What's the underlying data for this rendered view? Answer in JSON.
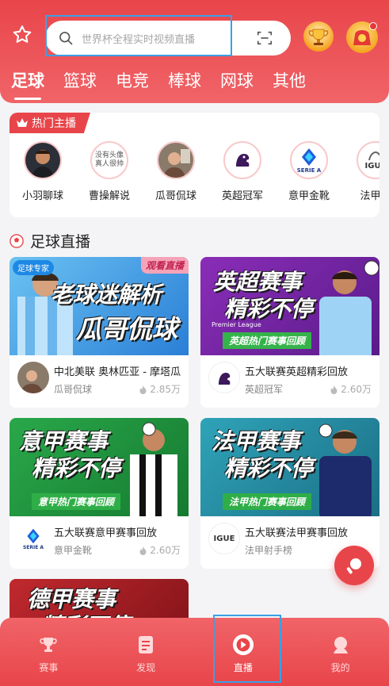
{
  "search": {
    "placeholder": "世界杯全程实时视频直播"
  },
  "tabs": [
    {
      "label": "足球",
      "active": true
    },
    {
      "label": "篮球"
    },
    {
      "label": "电竞"
    },
    {
      "label": "棒球"
    },
    {
      "label": "网球"
    },
    {
      "label": "其他"
    }
  ],
  "hot": {
    "tag": "热门主播",
    "streamers": [
      {
        "name": "小羽聊球"
      },
      {
        "name": "曹操解说",
        "avatar_text": "没有头像 真人很帅"
      },
      {
        "name": "瓜哥侃球"
      },
      {
        "name": "英超冠军"
      },
      {
        "name": "意甲金靴",
        "avatar_text": "SERIE A"
      },
      {
        "name": "法甲射",
        "avatar_text": "IGUE"
      }
    ]
  },
  "section": {
    "title": "足球直播"
  },
  "videos": [
    {
      "thumb_line1": "老球迷解析",
      "thumb_line2": "瓜哥侃球",
      "corner": "观看直播",
      "label_tl": "足球专家",
      "title": "中北美联 奥林匹亚 - 摩塔瓜",
      "host": "瓜哥侃球",
      "views": "2.85万"
    },
    {
      "thumb_line1": "英超赛事",
      "thumb_line2": "精彩不停",
      "strip": "英超热门赛事回顾",
      "caption": "Premier League",
      "title": "五大联赛英超精彩回放",
      "host": "英超冠军",
      "views": "2.60万"
    },
    {
      "thumb_line1": "意甲赛事",
      "thumb_line2": "精彩不停",
      "strip": "意甲热门赛事回顾",
      "title": "五大联赛意甲赛事回放",
      "host": "意甲金靴",
      "views": "2.60万",
      "host_avatar_text": "SERIE A"
    },
    {
      "thumb_line1": "法甲赛事",
      "thumb_line2": "精彩不停",
      "strip": "法甲热门赛事回顾",
      "title": "五大联赛法甲赛事回放",
      "host": "法甲射手榜",
      "views": "",
      "host_avatar_text": "IGUE"
    },
    {
      "thumb_line1": "德甲赛事",
      "thumb_line2": "精彩不停"
    }
  ],
  "nav": [
    {
      "label": "赛事"
    },
    {
      "label": "发现"
    },
    {
      "label": "直播",
      "active": true
    },
    {
      "label": "我的"
    }
  ],
  "colors": {
    "brand": "#e8454a",
    "highlight_box": "#3aa0e6"
  }
}
